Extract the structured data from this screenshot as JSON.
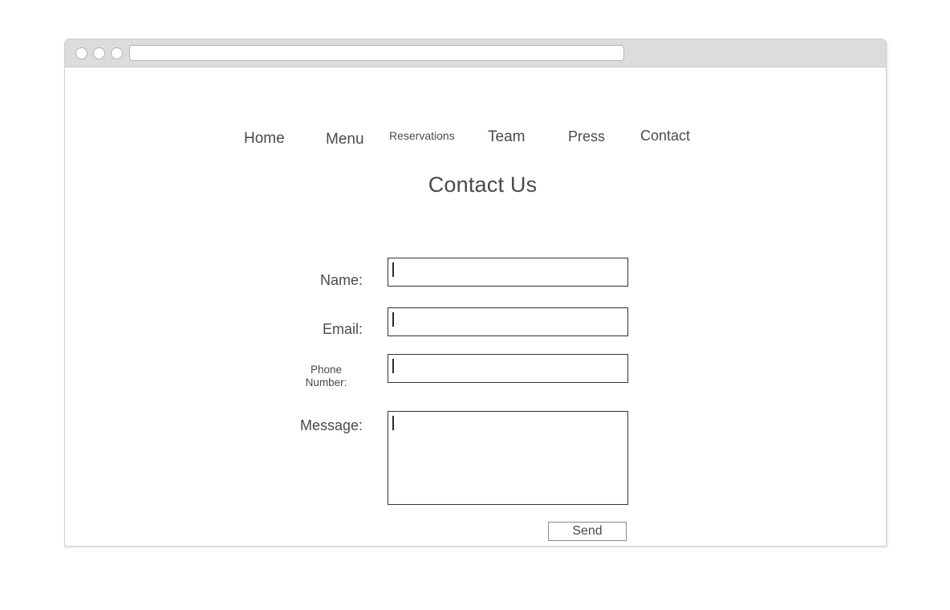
{
  "browser": {
    "traffic_lights": [
      "close-dot",
      "minimize-dot",
      "maximize-dot"
    ],
    "address_bar": {
      "value": "",
      "placeholder": ""
    }
  },
  "nav": {
    "items": [
      {
        "label": "Home"
      },
      {
        "label": "Menu"
      },
      {
        "label": "Reservations"
      },
      {
        "label": "Team"
      },
      {
        "label": "Press"
      },
      {
        "label": "Contact"
      }
    ]
  },
  "page": {
    "title": "Contact Us"
  },
  "form": {
    "fields": [
      {
        "label": "Name:",
        "value": "",
        "placeholder": "",
        "type": "text"
      },
      {
        "label": "Email:",
        "value": "",
        "placeholder": "",
        "type": "text"
      },
      {
        "label": "Phone Number:",
        "value": "",
        "placeholder": "",
        "type": "text"
      },
      {
        "label": "Message:",
        "value": "",
        "placeholder": "",
        "type": "textarea"
      }
    ],
    "submit_label": "Send"
  },
  "colors": {
    "titlebar": "#dcdcdc",
    "window_border": "#cfcfcf",
    "text": "#4a4a4a",
    "input_border": "#333333",
    "button_border": "#8a8a8a",
    "page_background": "#ffffff"
  }
}
